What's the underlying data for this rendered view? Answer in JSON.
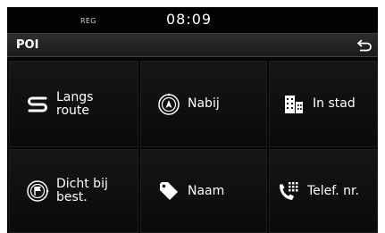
{
  "status": {
    "reg": "REG",
    "time": "08:09"
  },
  "header": {
    "title": "POI"
  },
  "menu": [
    {
      "label": "Langs\nroute",
      "icon": "route-icon"
    },
    {
      "label": "Nabij",
      "icon": "nearby-compass-icon"
    },
    {
      "label": "In stad",
      "icon": "city-buildings-icon"
    },
    {
      "label": "Dicht bij\nbest.",
      "icon": "destination-flag-icon"
    },
    {
      "label": "Naam",
      "icon": "tag-icon"
    },
    {
      "label": "Telef. nr.",
      "icon": "phone-keypad-icon"
    }
  ]
}
